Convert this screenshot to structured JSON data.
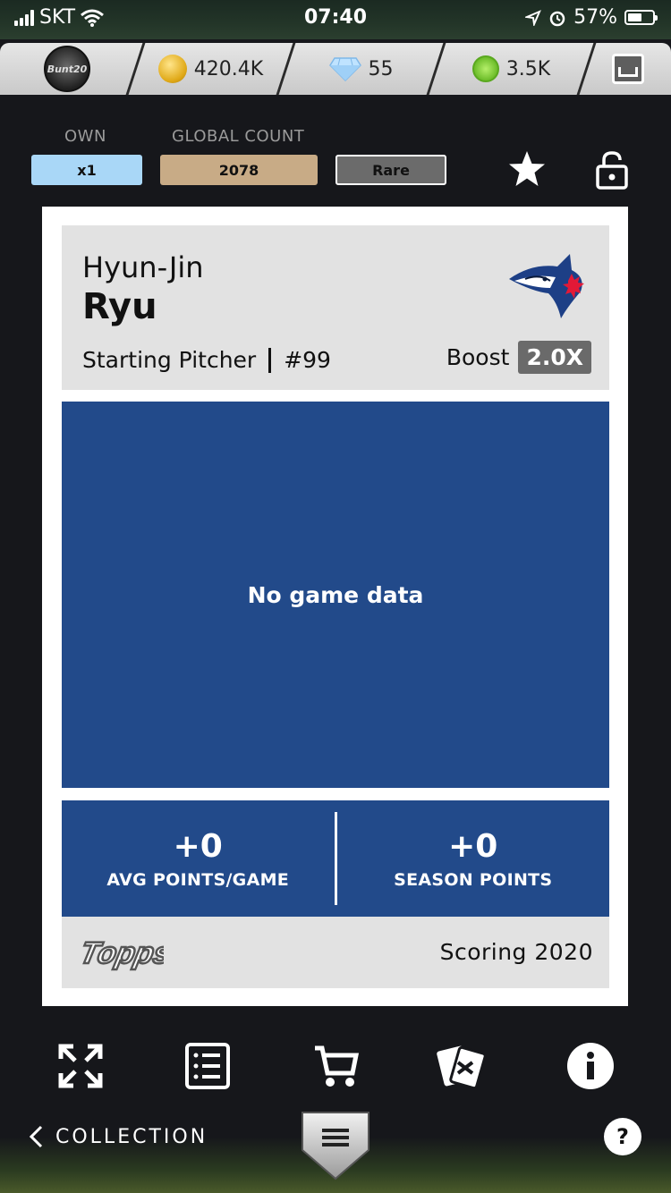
{
  "status_bar": {
    "carrier": "SKT",
    "time": "07:40",
    "battery": "57%"
  },
  "currency": {
    "avatar_text": "Bunt20",
    "coins": "420.4K",
    "gems": "55",
    "green": "3.5K"
  },
  "meta": {
    "own_label": "OWN",
    "global_label": "GLOBAL COUNT",
    "own_value": "x1",
    "global_value": "2078",
    "rarity": "Rare"
  },
  "card": {
    "first_name": "Hyun-Jin",
    "last_name": "Ryu",
    "position": "Starting Pitcher",
    "number": "#99",
    "boost_label": "Boost",
    "boost_value": "2.0X",
    "no_data": "No game data",
    "avg_points": "+0",
    "avg_label": "AVG POINTS/GAME",
    "season_points": "+0",
    "season_label": "SEASON POINTS",
    "brand": "Topps",
    "scoring": "Scoring 2020"
  },
  "nav": {
    "back_label": "COLLECTION",
    "help": "?"
  },
  "colors": {
    "card_blue": "#224a8a",
    "own_pill": "#a9d7f7",
    "global_pill": "#c8ab86",
    "rare_pill": "#6b6b6b"
  }
}
